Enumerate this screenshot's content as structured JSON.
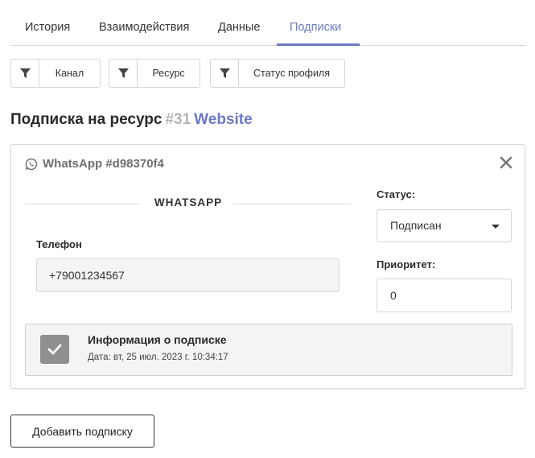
{
  "tabs": [
    {
      "label": "История"
    },
    {
      "label": "Взаимодействия"
    },
    {
      "label": "Данные"
    },
    {
      "label": "Подписки",
      "active": true
    }
  ],
  "filters": [
    {
      "label": "Канал",
      "icon": "filter-icon"
    },
    {
      "label": "Ресурс",
      "icon": "filter-icon"
    },
    {
      "label": "Статус профиля",
      "icon": "filter-icon"
    }
  ],
  "heading": {
    "text": "Подписка на ресурс",
    "number": "#31",
    "link": "Website"
  },
  "subscription": {
    "icon": "whatsapp-icon",
    "title": "WhatsApp #d98370f4",
    "section_title": "WHATSAPP",
    "phone_label": "Телефон",
    "phone_value": "+79001234567",
    "status_label": "Статус:",
    "status_value": "Подписан",
    "priority_label": "Приоритет:",
    "priority_value": "0",
    "info_title": "Информация о подписке",
    "info_date": "Дата: вт, 25 июл. 2023 г. 10:34:17"
  },
  "add_button": "Добавить подписку",
  "colors": {
    "accent": "#6b79c6",
    "muted_number": "#b4b4b4",
    "checkbox": "#8f8f8f"
  }
}
